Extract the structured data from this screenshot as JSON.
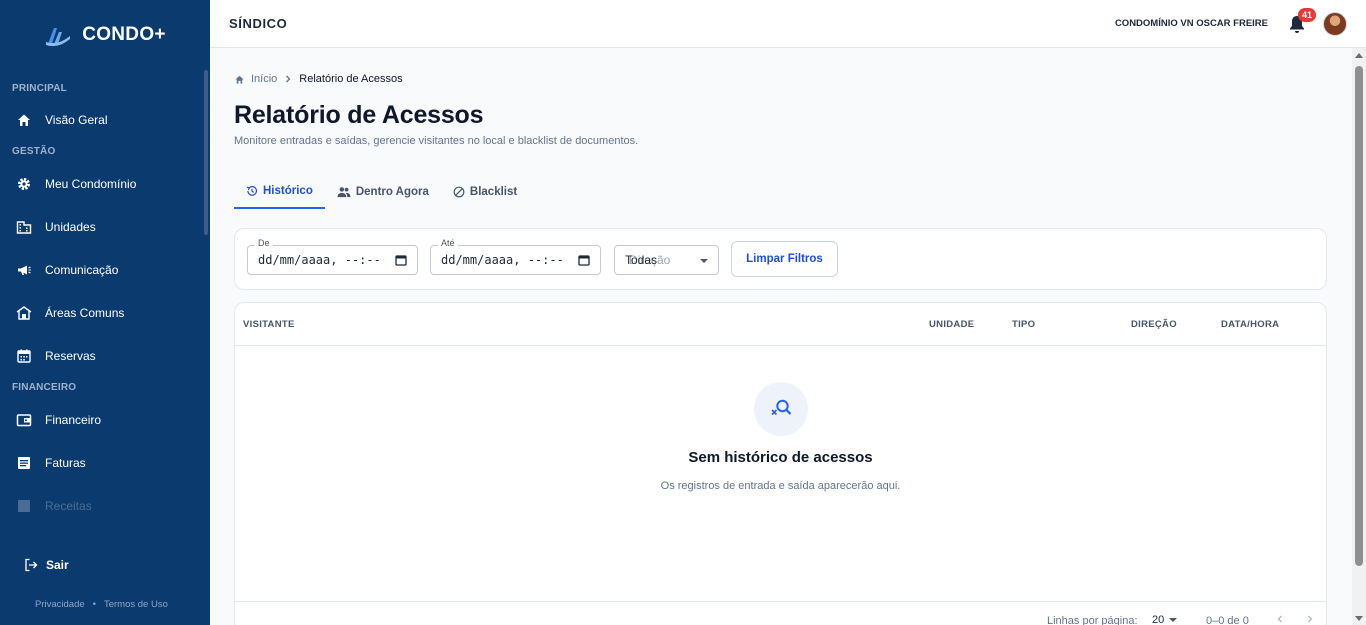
{
  "brand": {
    "name": "CONDO+"
  },
  "sidebar": {
    "sections": [
      {
        "title": "PRINCIPAL",
        "items": [
          {
            "label": "Visão Geral",
            "icon": "home-icon"
          }
        ]
      },
      {
        "title": "GESTÃO",
        "items": [
          {
            "label": "Meu Condomínio",
            "icon": "gear-icon"
          },
          {
            "label": "Unidades",
            "icon": "building-icon"
          },
          {
            "label": "Comunicação",
            "icon": "megaphone-icon"
          },
          {
            "label": "Áreas Comuns",
            "icon": "house-pool-icon"
          },
          {
            "label": "Reservas",
            "icon": "calendar-icon"
          }
        ]
      },
      {
        "title": "FINANCEIRO",
        "items": [
          {
            "label": "Financeiro",
            "icon": "wallet-icon"
          },
          {
            "label": "Faturas",
            "icon": "receipt-icon"
          },
          {
            "label": "Receitas",
            "icon": "list-icon"
          }
        ]
      }
    ],
    "logout": "Sair",
    "privacy": "Privacidade",
    "separator": "•",
    "terms": "Termos de Uso"
  },
  "header": {
    "role": "SÍNDICO",
    "condo": "CONDOMÍNIO VN OSCAR FREIRE",
    "notification_count": "41"
  },
  "breadcrumb": {
    "home": "Início",
    "current": "Relatório de Acessos"
  },
  "page": {
    "title": "Relatório de Acessos",
    "subtitle": "Monitore entradas e saídas, gerencie visitantes no local e blacklist de documentos."
  },
  "tabs": [
    {
      "label": "Histórico",
      "active": true
    },
    {
      "label": "Dentro Agora",
      "active": false
    },
    {
      "label": "Blacklist",
      "active": false
    }
  ],
  "filters": {
    "from_label": "De",
    "from_value": "dd/mm/aaaa, --:--",
    "to_label": "Até",
    "to_value": "dd/mm/aaaa, --:--",
    "direction_placeholder": "Direção",
    "direction_value": "Todas",
    "clear_button": "Limpar Filtros"
  },
  "table": {
    "columns": [
      "VISITANTE",
      "UNIDADE",
      "TIPO",
      "DIREÇÃO",
      "DATA/HORA"
    ],
    "empty_title": "Sem histórico de acessos",
    "empty_subtitle": "Os registros de entrada e saída aparecerão aqui.",
    "rows_per_page_label": "Linhas por página:",
    "rows_per_page": "20",
    "range": "0–0 de 0"
  },
  "colors": {
    "sidebar": "#0b3a6e",
    "accent": "#2563eb",
    "badge": "#e53935"
  }
}
